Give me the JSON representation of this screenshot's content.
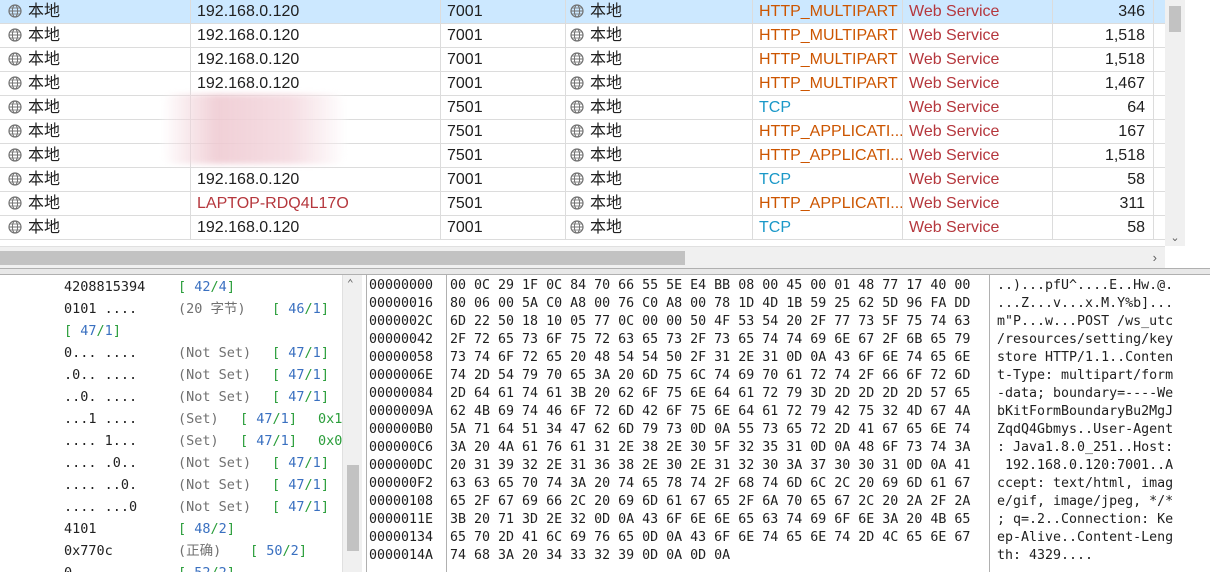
{
  "packet_rows": [
    {
      "src": "本地",
      "ip": "192.168.0.120",
      "port": "7001",
      "dst": "本地",
      "proto": "HTTP_MULTIPART",
      "app": "Web Service",
      "size": "346",
      "selected": true
    },
    {
      "src": "本地",
      "ip": "192.168.0.120",
      "port": "7001",
      "dst": "本地",
      "proto": "HTTP_MULTIPART",
      "app": "Web Service",
      "size": "1,518"
    },
    {
      "src": "本地",
      "ip": "192.168.0.120",
      "port": "7001",
      "dst": "本地",
      "proto": "HTTP_MULTIPART",
      "app": "Web Service",
      "size": "1,518"
    },
    {
      "src": "本地",
      "ip": "192.168.0.120",
      "port": "7001",
      "dst": "本地",
      "proto": "HTTP_MULTIPART",
      "app": "Web Service",
      "size": "1,467"
    },
    {
      "src": "本地",
      "ip": "",
      "port": "7501",
      "dst": "本地",
      "proto": "TCP",
      "app": "Web Service",
      "size": "64"
    },
    {
      "src": "本地",
      "ip": "",
      "port": "7501",
      "dst": "本地",
      "proto": "HTTP_APPLICATI...",
      "app": "Web Service",
      "size": "167"
    },
    {
      "src": "本地",
      "ip": "",
      "port": "7501",
      "dst": "本地",
      "proto": "HTTP_APPLICATI...",
      "app": "Web Service",
      "size": "1,518"
    },
    {
      "src": "本地",
      "ip": "192.168.0.120",
      "port": "7001",
      "dst": "本地",
      "proto": "TCP",
      "app": "Web Service",
      "size": "58"
    },
    {
      "src": "本地",
      "ip": "LAPTOP-RDQ4L17O",
      "ip_red": true,
      "port": "7501",
      "dst": "本地",
      "proto": "HTTP_APPLICATI...",
      "app": "Web Service",
      "size": "311"
    },
    {
      "src": "本地",
      "ip": "192.168.0.120",
      "port": "7001",
      "dst": "本地",
      "proto": "TCP",
      "app": "Web Service",
      "size": "58"
    }
  ],
  "detail_rows": [
    {
      "value": "4208815394",
      "meaning": "",
      "ref": "42",
      "len": "4",
      "extra": ""
    },
    {
      "value": "0101 ....",
      "meaning": "(20 字节)",
      "ref": "46",
      "len": "1",
      "extra": ""
    },
    {
      "value": "",
      "meaning": "",
      "ref": "47",
      "len": "1",
      "extra": "",
      "indent_ref": true
    },
    {
      "value": "0... ....",
      "meaning": "(Not Set)",
      "ref": "47",
      "len": "1",
      "extra": ""
    },
    {
      "value": ".0.. ....",
      "meaning": "(Not Set)",
      "ref": "47",
      "len": "1",
      "extra": ""
    },
    {
      "value": "..0. ....",
      "meaning": "(Not Set)",
      "ref": "47",
      "len": "1",
      "extra": ""
    },
    {
      "value": "...1 ....",
      "meaning": "(Set)",
      "ref": "47",
      "len": "1",
      "extra": "0x1"
    },
    {
      "value": ".... 1...",
      "meaning": "(Set)",
      "ref": "47",
      "len": "1",
      "extra": "0x0"
    },
    {
      "value": ".... .0..",
      "meaning": "(Not Set)",
      "ref": "47",
      "len": "1",
      "extra": ""
    },
    {
      "value": ".... ..0.",
      "meaning": "(Not Set)",
      "ref": "47",
      "len": "1",
      "extra": ""
    },
    {
      "value": ".... ...0",
      "meaning": "(Not Set)",
      "ref": "47",
      "len": "1",
      "extra": ""
    },
    {
      "value": "4101",
      "meaning": "",
      "ref": "48",
      "len": "2",
      "extra": ""
    },
    {
      "value": "0x770c",
      "meaning": "(正确)",
      "ref": "50",
      "len": "2",
      "extra": ""
    },
    {
      "value": "0",
      "meaning": "",
      "ref": "52",
      "len": "2",
      "extra": ""
    }
  ],
  "hex_rows": [
    {
      "offset": "00000000",
      "bytes": "00 0C 29 1F 0C 84 70 66 55 5E E4 BB 08 00 45 00 01 48 77 17 40 00",
      "ascii": "..)...pfU^....E..Hw.@."
    },
    {
      "offset": "00000016",
      "bytes": "80 06 00 5A C0 A8 00 76 C0 A8 00 78 1D 4D 1B 59 25 62 5D 96 FA DD",
      "ascii": "...Z...v...x.M.Y%b]..."
    },
    {
      "offset": "0000002C",
      "bytes": "6D 22 50 18 10 05 77 0C 00 00 50 4F 53 54 20 2F 77 73 5F 75 74 63",
      "ascii": "m\"P...w...POST /ws_utc"
    },
    {
      "offset": "00000042",
      "bytes": "2F 72 65 73 6F 75 72 63 65 73 2F 73 65 74 74 69 6E 67 2F 6B 65 79",
      "ascii": "/resources/setting/key"
    },
    {
      "offset": "00000058",
      "bytes": "73 74 6F 72 65 20 48 54 54 50 2F 31 2E 31 0D 0A 43 6F 6E 74 65 6E",
      "ascii": "store HTTP/1.1..Conten"
    },
    {
      "offset": "0000006E",
      "bytes": "74 2D 54 79 70 65 3A 20 6D 75 6C 74 69 70 61 72 74 2F 66 6F 72 6D",
      "ascii": "t-Type: multipart/form"
    },
    {
      "offset": "00000084",
      "bytes": "2D 64 61 74 61 3B 20 62 6F 75 6E 64 61 72 79 3D 2D 2D 2D 2D 57 65",
      "ascii": "-data; boundary=----We"
    },
    {
      "offset": "0000009A",
      "bytes": "62 4B 69 74 46 6F 72 6D 42 6F 75 6E 64 61 72 79 42 75 32 4D 67 4A",
      "ascii": "bKitFormBoundaryBu2MgJ"
    },
    {
      "offset": "000000B0",
      "bytes": "5A 71 64 51 34 47 62 6D 79 73 0D 0A 55 73 65 72 2D 41 67 65 6E 74",
      "ascii": "ZqdQ4Gbmys..User-Agent"
    },
    {
      "offset": "000000C6",
      "bytes": "3A 20 4A 61 76 61 31 2E 38 2E 30 5F 32 35 31 0D 0A 48 6F 73 74 3A",
      "ascii": ": Java1.8.0_251..Host:"
    },
    {
      "offset": "000000DC",
      "bytes": "20 31 39 32 2E 31 36 38 2E 30 2E 31 32 30 3A 37 30 30 31 0D 0A 41",
      "ascii": " 192.168.0.120:7001..A"
    },
    {
      "offset": "000000F2",
      "bytes": "63 63 65 70 74 3A 20 74 65 78 74 2F 68 74 6D 6C 2C 20 69 6D 61 67",
      "ascii": "ccept: text/html, imag"
    },
    {
      "offset": "00000108",
      "bytes": "65 2F 67 69 66 2C 20 69 6D 61 67 65 2F 6A 70 65 67 2C 20 2A 2F 2A",
      "ascii": "e/gif, image/jpeg, */*"
    },
    {
      "offset": "0000011E",
      "bytes": "3B 20 71 3D 2E 32 0D 0A 43 6F 6E 6E 65 63 74 69 6F 6E 3A 20 4B 65",
      "ascii": "; q=.2..Connection: Ke"
    },
    {
      "offset": "00000134",
      "bytes": "65 70 2D 41 6C 69 76 65 0D 0A 43 6F 6E 74 65 6E 74 2D 4C 65 6E 67",
      "ascii": "ep-Alive..Content-Leng"
    },
    {
      "offset": "0000014A",
      "bytes": "74 68 3A 20 34 33 32 39 0D 0A 0D 0A",
      "ascii": "th: 4329...."
    }
  ],
  "colors": {
    "selected_row": "#cce8ff",
    "http_protocol": "#cc5500",
    "tcp_protocol": "#1a98c8",
    "app_name": "#b5373d",
    "ref_green": "#2a9d3a",
    "ref_blue": "#3a70c0"
  },
  "icons": {
    "location": "globe-icon",
    "scroll_down": "chevron-down-icon",
    "scroll_right": "chevron-right-icon",
    "scroll_up": "chevron-up-icon"
  }
}
